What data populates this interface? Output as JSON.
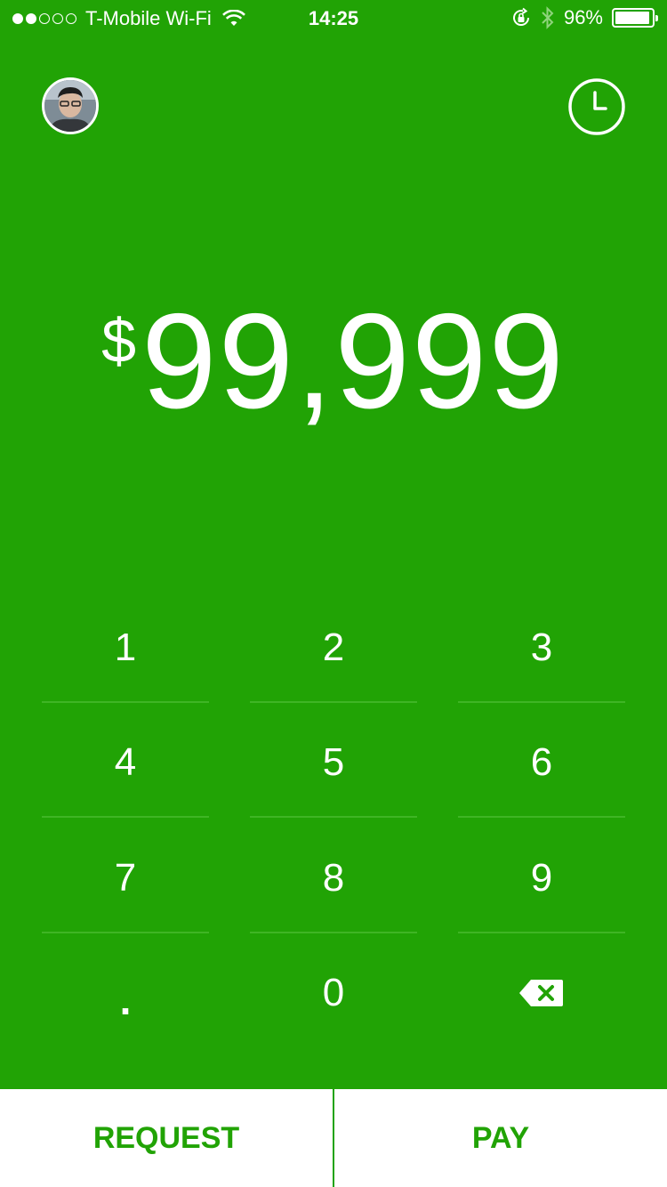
{
  "status_bar": {
    "signal_filled": 2,
    "signal_total": 5,
    "carrier": "T-Mobile Wi-Fi",
    "time": "14:25",
    "battery_percent": "96%",
    "battery_level": 0.96
  },
  "header": {
    "avatar_icon": "user-avatar",
    "history_icon": "clock-icon"
  },
  "amount": {
    "currency": "$",
    "value": "99,999"
  },
  "keypad": {
    "keys": [
      "1",
      "2",
      "3",
      "4",
      "5",
      "6",
      "7",
      "8",
      "9",
      ".",
      "0",
      "backspace"
    ]
  },
  "actions": {
    "request_label": "REQUEST",
    "pay_label": "PAY"
  },
  "colors": {
    "brand_green": "#21a305",
    "white": "#ffffff"
  }
}
